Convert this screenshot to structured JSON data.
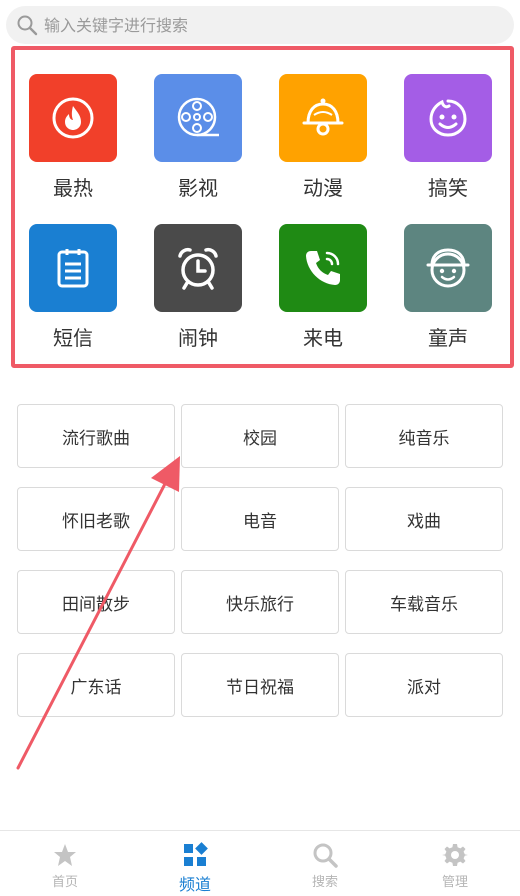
{
  "search": {
    "placeholder": "输入关键字进行搜索",
    "icon": "search-icon"
  },
  "categories": [
    {
      "label": "最热",
      "icon": "fire-icon",
      "color": "#f1402a"
    },
    {
      "label": "影视",
      "icon": "film-reel-icon",
      "color": "#5b8ee8"
    },
    {
      "label": "动漫",
      "icon": "bell-icon",
      "color": "#ffa200"
    },
    {
      "label": "搞笑",
      "icon": "smile-icon",
      "color": "#a45de6"
    },
    {
      "label": "短信",
      "icon": "clipboard-icon",
      "color": "#1a7fd2"
    },
    {
      "label": "闹钟",
      "icon": "alarm-clock-icon",
      "color": "#4a4a4a"
    },
    {
      "label": "来电",
      "icon": "phone-icon",
      "color": "#1f8a14"
    },
    {
      "label": "童声",
      "icon": "kid-face-icon",
      "color": "#5d8580"
    }
  ],
  "tags": [
    "流行歌曲",
    "校园",
    "纯音乐",
    "怀旧老歌",
    "电音",
    "戏曲",
    "田间散步",
    "快乐旅行",
    "车载音乐",
    "广东话",
    "节日祝福",
    "派对"
  ],
  "tabbar": {
    "items": [
      {
        "label": "首页",
        "icon": "star-icon"
      },
      {
        "label": "频道",
        "icon": "grid-icon"
      },
      {
        "label": "搜索",
        "icon": "search-icon"
      },
      {
        "label": "管理",
        "icon": "gear-icon"
      }
    ],
    "active": "频道",
    "active_color": "#1a7fd2",
    "inactive_color": "#b5b5b5"
  },
  "annotation": {
    "highlight_color": "#ef5a66"
  }
}
